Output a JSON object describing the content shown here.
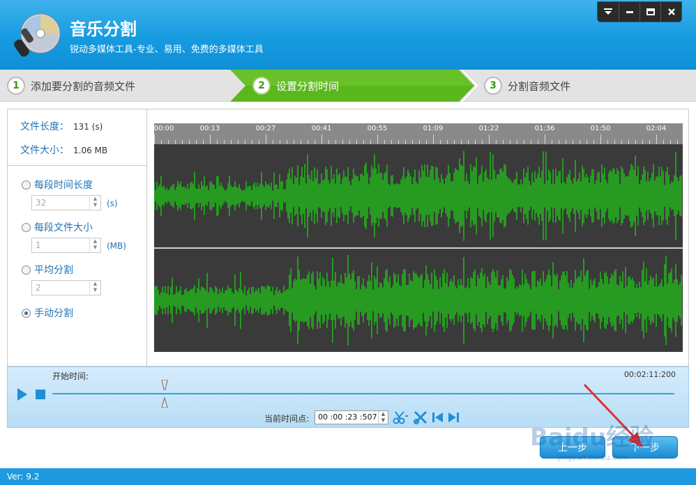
{
  "app": {
    "title": "音乐分割",
    "subtitle": "锐动多媒体工具-专业、易用、免费的多媒体工具",
    "window_controls": [
      "menu-icon",
      "minimize-icon",
      "maximize-icon",
      "close-icon"
    ]
  },
  "steps": [
    {
      "num": "1",
      "label": "添加要分割的音频文件",
      "active": false
    },
    {
      "num": "2",
      "label": "设置分割时间",
      "active": true
    },
    {
      "num": "3",
      "label": "分割音频文件",
      "active": false
    }
  ],
  "file_info": {
    "length_label": "文件长度：",
    "length_value": "131 (s)",
    "size_label": "文件大小：",
    "size_value": "1.06 MB"
  },
  "options": [
    {
      "label": "每段时间长度",
      "value": "32",
      "unit": "(s)",
      "selected": false
    },
    {
      "label": "每段文件大小",
      "value": "1",
      "unit": "(MB)",
      "selected": false
    },
    {
      "label": "平均分割",
      "value": "2",
      "unit": "",
      "selected": false
    },
    {
      "label": "手动分割",
      "selected": true
    }
  ],
  "timeline": {
    "ticks": [
      "00:00",
      "00:13",
      "00:27",
      "00:41",
      "00:55",
      "01:09",
      "01:22",
      "01:36",
      "01:50",
      "02:04"
    ]
  },
  "control": {
    "start_label": "开始时间:",
    "end_time": "00:02:11:200",
    "current_label": "当前时间点:",
    "current_value": "00 :00 :23 :507",
    "thumb_fraction": 0.18
  },
  "buttons": {
    "prev": "上一步",
    "next": "下一步"
  },
  "footer": {
    "version": "Ver: 9.2"
  },
  "watermark": {
    "text": "Baidu经验",
    "url": "jingyan.baidu.com"
  },
  "colors": {
    "accent": "#169be0",
    "active_step": "#5ab71c",
    "wave": "#22b21b"
  }
}
